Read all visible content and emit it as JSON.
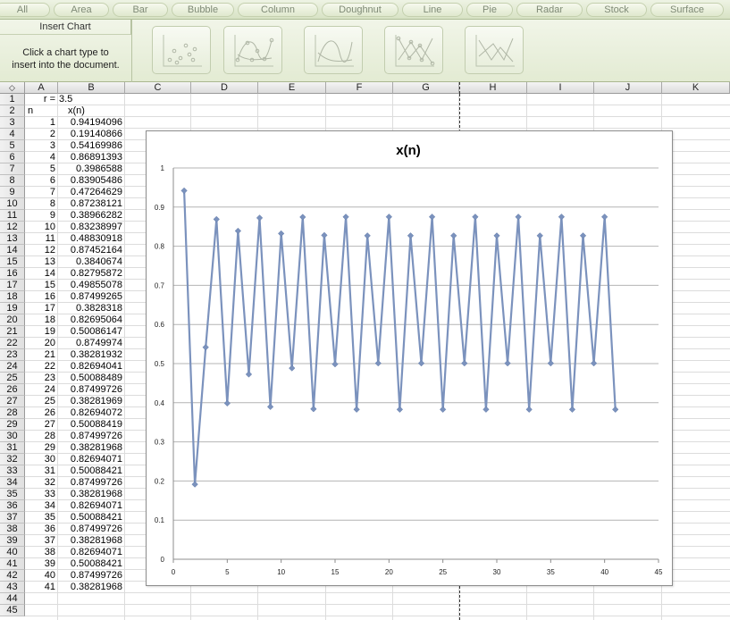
{
  "ribbon": {
    "tabs": [
      "All",
      "Area",
      "Bar",
      "Bubble",
      "Column",
      "Doughnut",
      "Line",
      "Pie",
      "Radar",
      "Stock",
      "Surface"
    ],
    "group_title": "Insert Chart",
    "help_line1": "Click a chart type to",
    "help_line2": "insert into the document.",
    "thumbnails": [
      "scatter-markers-icon",
      "scatter-smooth-markers-icon",
      "scatter-smooth-icon",
      "scatter-straight-markers-icon",
      "scatter-straight-icon"
    ]
  },
  "sheet": {
    "corner": "◇",
    "columns": [
      "A",
      "B",
      "C",
      "D",
      "E",
      "F",
      "G",
      "H",
      "I",
      "J",
      "K"
    ],
    "rows": [
      "1",
      "2",
      "3",
      "4",
      "5",
      "6",
      "7",
      "8",
      "9",
      "10",
      "11",
      "12",
      "13",
      "14",
      "15",
      "16",
      "17",
      "18",
      "19",
      "20",
      "21",
      "22",
      "23",
      "24",
      "25",
      "26",
      "27",
      "28",
      "29",
      "30",
      "31",
      "32",
      "33",
      "34",
      "35",
      "36",
      "37",
      "38",
      "39",
      "40",
      "41",
      "42",
      "43",
      "44",
      "45"
    ],
    "r_label": "r =",
    "r_value": "3.5",
    "n_header": "n",
    "x_header": "x(n)",
    "n_values": [
      "1",
      "2",
      "3",
      "4",
      "5",
      "6",
      "7",
      "8",
      "9",
      "10",
      "11",
      "12",
      "13",
      "14",
      "15",
      "16",
      "17",
      "18",
      "19",
      "20",
      "21",
      "22",
      "23",
      "24",
      "25",
      "26",
      "27",
      "28",
      "29",
      "30",
      "31",
      "32",
      "33",
      "34",
      "35",
      "36",
      "37",
      "38",
      "39",
      "40",
      "41"
    ],
    "x_values": [
      "0.94194096",
      "0.19140866",
      "0.54169986",
      "0.86891393",
      "0.3986588",
      "0.83905486",
      "0.47264629",
      "0.87238121",
      "0.38966282",
      "0.83238997",
      "0.48830918",
      "0.87452164",
      "0.3840674",
      "0.82795872",
      "0.49855078",
      "0.87499265",
      "0.3828318",
      "0.82695064",
      "0.50086147",
      "0.8749974",
      "0.38281932",
      "0.82694041",
      "0.50088489",
      "0.87499726",
      "0.38281969",
      "0.82694072",
      "0.50088419",
      "0.87499726",
      "0.38281968",
      "0.82694071",
      "0.50088421",
      "0.87499726",
      "0.38281968",
      "0.82694071",
      "0.50088421",
      "0.87499726",
      "0.38281968",
      "0.82694071",
      "0.50088421",
      "0.87499726",
      "0.38281968"
    ]
  },
  "colors": {
    "series": "#7b92bd",
    "accent": "#d7e2c4"
  },
  "chart_data": {
    "type": "line",
    "title": "x(n)",
    "xlabel": "",
    "ylabel": "",
    "xlim": [
      0,
      45
    ],
    "ylim": [
      0,
      1
    ],
    "x_ticks": [
      "0",
      "5",
      "10",
      "15",
      "20",
      "25",
      "30",
      "35",
      "40",
      "45"
    ],
    "y_ticks": [
      "0",
      "0.1",
      "0.2",
      "0.3",
      "0.4",
      "0.5",
      "0.6",
      "0.7",
      "0.8",
      "0.9",
      "1"
    ],
    "grid": "horizontal",
    "legend": "none",
    "series": [
      {
        "x": [
          1,
          2,
          3,
          4,
          5,
          6,
          7,
          8,
          9,
          10,
          11,
          12,
          13,
          14,
          15,
          16,
          17,
          18,
          19,
          20,
          21,
          22,
          23,
          24,
          25,
          26,
          27,
          28,
          29,
          30,
          31,
          32,
          33,
          34,
          35,
          36,
          37,
          38,
          39,
          40,
          41
        ],
        "values": [
          0.94194096,
          0.19140866,
          0.54169986,
          0.86891393,
          0.3986588,
          0.83905486,
          0.47264629,
          0.87238121,
          0.38966282,
          0.83238997,
          0.48830918,
          0.87452164,
          0.3840674,
          0.82795872,
          0.49855078,
          0.87499265,
          0.3828318,
          0.82695064,
          0.50086147,
          0.8749974,
          0.38281932,
          0.82694041,
          0.50088489,
          0.87499726,
          0.38281969,
          0.82694072,
          0.50088419,
          0.87499726,
          0.38281968,
          0.82694071,
          0.50088421,
          0.87499726,
          0.38281968,
          0.82694071,
          0.50088421,
          0.87499726,
          0.38281968,
          0.82694071,
          0.50088421,
          0.87499726,
          0.38281968
        ]
      }
    ]
  }
}
